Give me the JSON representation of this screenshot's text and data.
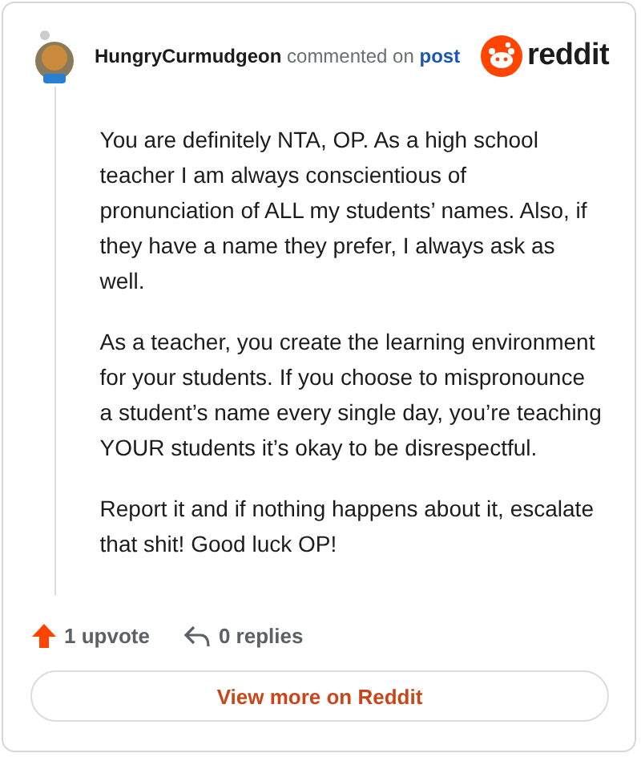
{
  "comment": {
    "author": "HungryCurmudgeon",
    "action": "commented on",
    "link": "post"
  },
  "brand": {
    "wordmark": "reddit"
  },
  "paragraphs": [
    "You are definitely NTA, OP. As a high school teacher I am always conscientious of pronunciation of ALL my students’ names. Also, if they have a name they prefer, I always ask as well.",
    "As a teacher, you create the learning environment for your students. If you choose to mispronounce a student’s name every single day, you’re teaching YOUR students it’s okay to be disrespectful.",
    "Report it and if nothing happens about it, escalate that shit! Good luck OP!"
  ],
  "stats": {
    "upvotes": "1 upvote",
    "replies": "0 replies"
  },
  "button": "View more on Reddit"
}
